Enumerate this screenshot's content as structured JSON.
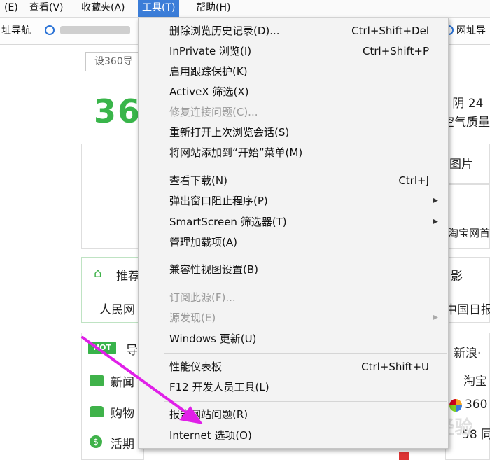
{
  "menubar": {
    "items": [
      "(E)",
      "查看(V)",
      "收藏夹(A)",
      "工具(T)",
      "帮助(H)"
    ]
  },
  "favorites": {
    "left_label": "址导航",
    "right_label": "网址导"
  },
  "page": {
    "search_placeholder": "设360导",
    "logo": "360",
    "weather_line1": "今 阴 24",
    "weather_line2": "空气质量:",
    "tab_images": "图片",
    "taobao_text": "淘宝网首",
    "recommend": "推荐",
    "movie": "影",
    "renmin": "人民网",
    "chinadaily": "中国日报",
    "hot_badge": "HOT",
    "nav_title": "导",
    "news": "新闻",
    "shopping": "购物",
    "activity": "活期",
    "sina": "新浪·",
    "taobao": "淘宝",
    "c360": "360",
    "tongcheng": "58 同",
    "watermark": "Baidu经验"
  },
  "menu": {
    "items": [
      {
        "label": "删除浏览历史记录(D)...",
        "shortcut": "Ctrl+Shift+Del"
      },
      {
        "label": "InPrivate 浏览(I)",
        "shortcut": "Ctrl+Shift+P"
      },
      {
        "label": "启用跟踪保护(K)",
        "shortcut": ""
      },
      {
        "label": "ActiveX 筛选(X)",
        "shortcut": ""
      },
      {
        "label": "修复连接问题(C)...",
        "shortcut": ""
      },
      {
        "label": "重新打开上次浏览会话(S)",
        "shortcut": ""
      },
      {
        "label": "将网站添加到“开始”菜单(M)",
        "shortcut": ""
      },
      {
        "label": "查看下载(N)",
        "shortcut": "Ctrl+J"
      },
      {
        "label": "弹出窗口阻止程序(P)",
        "shortcut": ""
      },
      {
        "label": "SmartScreen 筛选器(T)",
        "shortcut": ""
      },
      {
        "label": "管理加载项(A)",
        "shortcut": ""
      },
      {
        "label": "兼容性视图设置(B)",
        "shortcut": ""
      },
      {
        "label": "订阅此源(F)...",
        "shortcut": ""
      },
      {
        "label": "源发现(E)",
        "shortcut": ""
      },
      {
        "label": "Windows 更新(U)",
        "shortcut": ""
      },
      {
        "label": "性能仪表板",
        "shortcut": "Ctrl+Shift+U"
      },
      {
        "label": "F12 开发人员工具(L)",
        "shortcut": ""
      },
      {
        "label": "报告网站问题(R)",
        "shortcut": ""
      },
      {
        "label": "Internet 选项(O)",
        "shortcut": ""
      }
    ]
  },
  "colors": {
    "accent": "#3b7dd8",
    "logo_green": "#39b54a",
    "annotation_arrow": "#e020e8"
  }
}
